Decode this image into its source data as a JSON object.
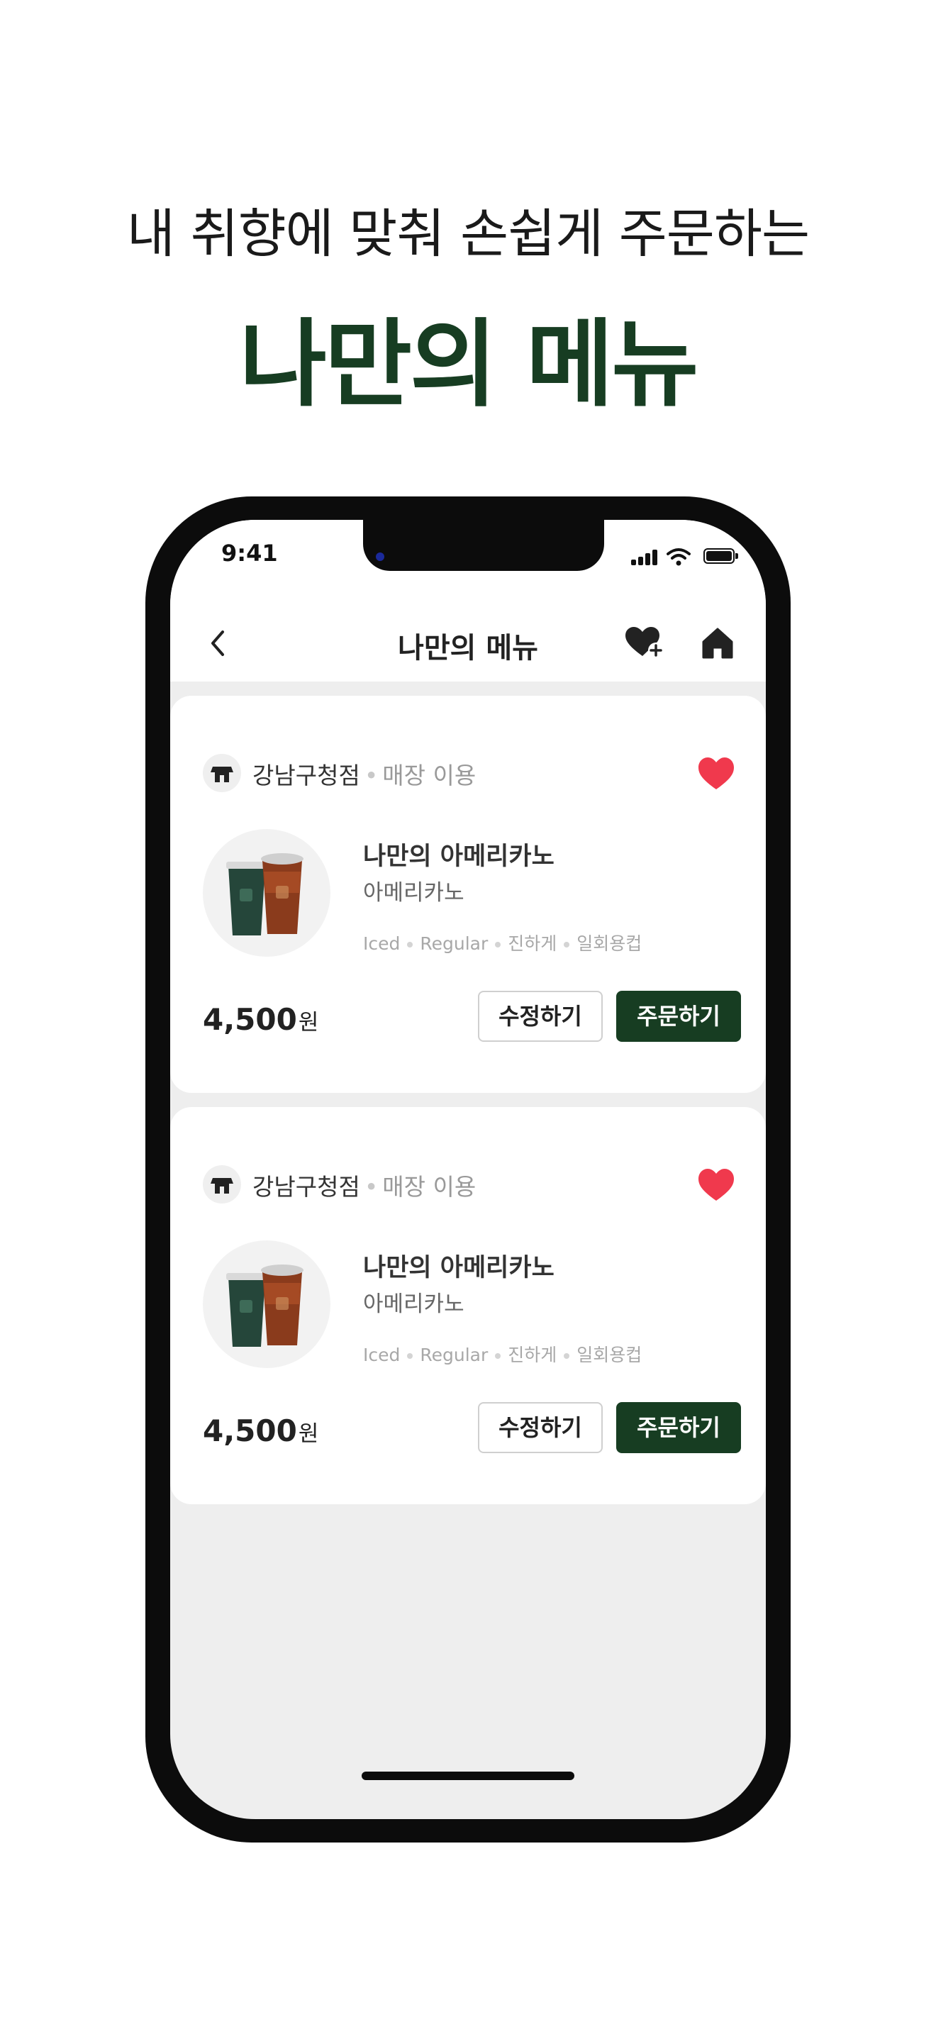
{
  "hero": {
    "subtitle": "내 취향에 맞춰 손쉽게 주문하는",
    "title": "나만의 메뉴"
  },
  "status_bar": {
    "time": "9:41"
  },
  "nav": {
    "title": "나만의 메뉴",
    "back_icon": "chevron-left-icon",
    "favorite_add_icon": "heart-plus-icon",
    "home_icon": "home-icon"
  },
  "cards": [
    {
      "store": "강남구청점",
      "separator": "•",
      "mode": "매장 이용",
      "name": "나만의 아메리카노",
      "base": "아메리카노",
      "options": [
        "Iced",
        "Regular",
        "진하게",
        "일회용컵"
      ],
      "price": "4,500",
      "price_unit": "원",
      "edit_label": "수정하기",
      "order_label": "주문하기",
      "favorited": true
    },
    {
      "store": "강남구청점",
      "separator": "•",
      "mode": "매장 이용",
      "name": "나만의 아메리카노",
      "base": "아메리카노",
      "options": [
        "Iced",
        "Regular",
        "진하게",
        "일회용컵"
      ],
      "price": "4,500",
      "price_unit": "원",
      "edit_label": "수정하기",
      "order_label": "주문하기",
      "favorited": true
    }
  ],
  "colors": {
    "brand_green": "#173d22",
    "heart_red": "#f0394d",
    "screen_bg": "#eeeeee"
  }
}
